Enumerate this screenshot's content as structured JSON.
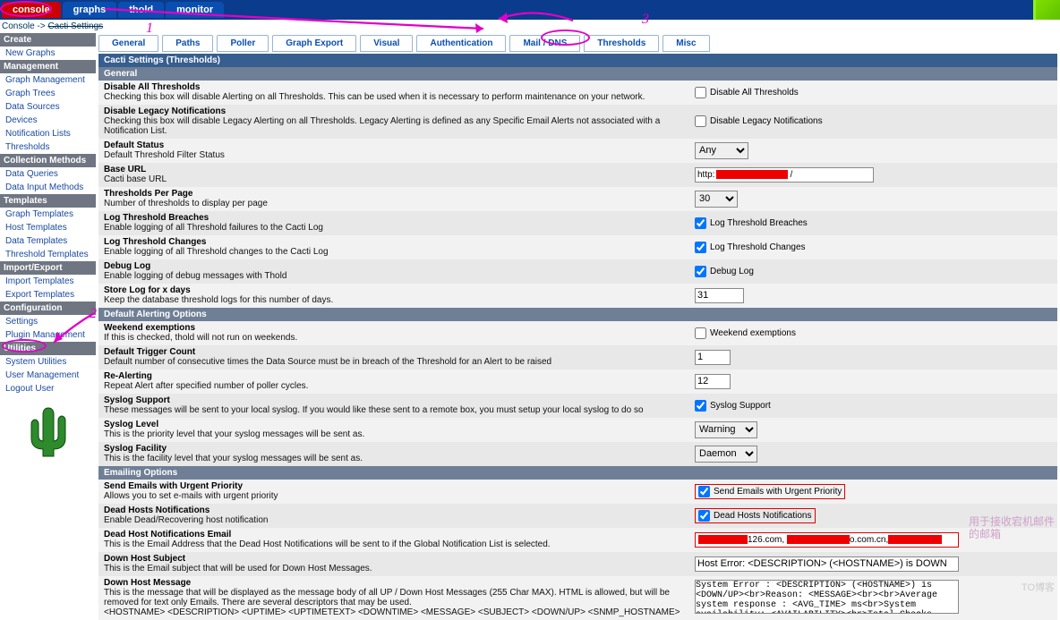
{
  "top_tabs": {
    "console": "console",
    "graphs": "graphs",
    "thold": "thold",
    "monitor": "monitor"
  },
  "breadcrumb": {
    "a": "Console",
    "b": "->",
    "c": "Cacti Settings"
  },
  "sidebar": {
    "create": "Create",
    "new_graphs": "New Graphs",
    "management": "Management",
    "graph_mgmt": "Graph Management",
    "graph_trees": "Graph Trees",
    "data_sources": "Data Sources",
    "devices": "Devices",
    "notif": "Notification Lists",
    "thresholds": "Thresholds",
    "collection": "Collection Methods",
    "data_queries": "Data Queries",
    "data_input": "Data Input Methods",
    "templates": "Templates",
    "graph_tmpl": "Graph Templates",
    "host_tmpl": "Host Templates",
    "data_tmpl": "Data Templates",
    "thold_tmpl": "Threshold Templates",
    "importexport": "Import/Export",
    "import_tmpl": "Import Templates",
    "export_tmpl": "Export Templates",
    "config": "Configuration",
    "settings": "Settings",
    "plugin": "Plugin Management",
    "utilities": "Utilities",
    "sysutil": "System Utilities",
    "usermgmt": "User Management",
    "logout": "Logout User"
  },
  "tabs": {
    "general": "General",
    "paths": "Paths",
    "poller": "Poller",
    "gexport": "Graph Export",
    "visual": "Visual",
    "auth": "Authentication",
    "mail": "Mail / DNS",
    "thresholds": "Thresholds",
    "misc": "Misc"
  },
  "title": "Cacti Settings (Thresholds)",
  "sub": {
    "general": "General",
    "alerting": "Default Alerting Options",
    "email": "Emailing Options"
  },
  "rows": {
    "disable_all": {
      "t": "Disable All Thresholds",
      "d": "Checking this box will disable Alerting on all Thresholds. This can be used when it is necessary to perform maintenance on your network.",
      "cb": "Disable All Thresholds"
    },
    "legacy": {
      "t": "Disable Legacy Notifications",
      "d": "Checking this box will disable Legacy Alerting on all Thresholds. Legacy Alerting is defined as any Specific Email Alerts not associated with a Notification List.",
      "cb": "Disable Legacy Notifications"
    },
    "status": {
      "t": "Default Status",
      "d": "Default Threshold Filter Status",
      "v": "Any"
    },
    "baseurl": {
      "t": "Base URL",
      "d": "Cacti base URL",
      "pre": "http:",
      "post": "/"
    },
    "perpage": {
      "t": "Thresholds Per Page",
      "d": "Number of thresholds to display per page",
      "v": "30"
    },
    "logbreach": {
      "t": "Log Threshold Breaches",
      "d": "Enable logging of all Threshold failures to the Cacti Log",
      "cb": "Log Threshold Breaches"
    },
    "logchange": {
      "t": "Log Threshold Changes",
      "d": "Enable logging of all Threshold changes to the Cacti Log",
      "cb": "Log Threshold Changes"
    },
    "debug": {
      "t": "Debug Log",
      "d": "Enable logging of debug messages with Thold",
      "cb": "Debug Log"
    },
    "storelog": {
      "t": "Store Log for x days",
      "d": "Keep the database threshold logs for this number of days.",
      "v": "31"
    },
    "weekend": {
      "t": "Weekend exemptions",
      "d": "If this is checked, thold will not run on weekends.",
      "cb": "Weekend exemptions"
    },
    "trigger": {
      "t": "Default Trigger Count",
      "d": "Default number of consecutive times the Data Source must be in breach of the Threshold for an Alert to be raised",
      "v": "1"
    },
    "realert": {
      "t": "Re-Alerting",
      "d": "Repeat Alert after specified number of poller cycles.",
      "v": "12"
    },
    "syslog": {
      "t": "Syslog Support",
      "d": "These messages will be sent to your local syslog. If you would like these sent to a remote box, you must setup your local syslog to do so",
      "cb": "Syslog Support"
    },
    "sysloglvl": {
      "t": "Syslog Level",
      "d": "This is the priority level that your syslog messages will be sent as.",
      "v": "Warning"
    },
    "syslogfac": {
      "t": "Syslog Facility",
      "d": "This is the facility level that your syslog messages will be sent as.",
      "v": "Daemon"
    },
    "urgent": {
      "t": "Send Emails with Urgent Priority",
      "d": "Allows you to set e-mails with urgent priority",
      "cb": "Send Emails with Urgent Priority"
    },
    "deadnotif": {
      "t": "Dead Hosts Notifications",
      "d": "Enable Dead/Recovering host notification",
      "cb": "Dead Hosts Notifications"
    },
    "deademail": {
      "t": "Dead Host Notifications Email",
      "d": "This is the Email Address that the Dead Host Notifications will be sent to if the Global Notification List is selected.",
      "frag1": "126.com,",
      "frag2": "o.com.cn,"
    },
    "downsubj": {
      "t": "Down Host Subject",
      "d": "This is the Email subject that will be used for Down Host Messages.",
      "v": "Host Error: <DESCRIPTION> (<HOSTNAME>) is DOWN"
    },
    "downmsg": {
      "t": "Down Host Message",
      "d": "This is the message that will be displayed as the message body of all UP / Down Host Messages (255 Char MAX). HTML is allowed, but will be removed for text only Emails. There are several descriptors that may be used.",
      "d2": "<HOSTNAME> <DESCRIPTION> <UPTIME> <UPTIMETEXT> <DOWNTIME> <MESSAGE> <SUBJECT> <DOWN/UP> <SNMP_HOSTNAME>",
      "v": "System Error : <DESCRIPTION> (<HOSTNAME>) is <DOWN/UP><br>Reason: <MESSAGE><br><br>Average system response : <AVG_TIME> ms<br>System availability: <AVAILABILITY><br>Total Checks Since Clear: <TOT_POLL><br>Total Failed Checks: <FAIL_POLL><br>Last Date Checked DOWN :"
    }
  },
  "annot": {
    "n1": "1",
    "n2": "2",
    "n3": "3",
    "side": "用于接收宕机邮件的邮箱",
    "wm": "TO博客"
  }
}
